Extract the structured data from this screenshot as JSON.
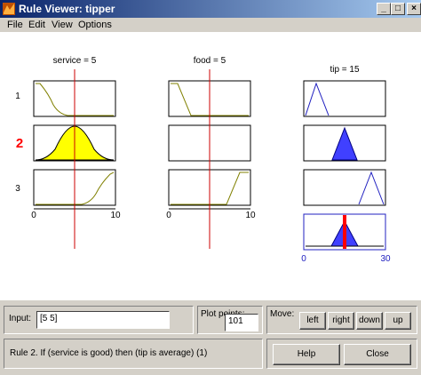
{
  "window": {
    "title": "Rule Viewer: tipper"
  },
  "menu": [
    "File",
    "Edit",
    "View",
    "Options"
  ],
  "columns": {
    "service": {
      "label": "service = 5"
    },
    "food": {
      "label": "food = 5"
    },
    "tip": {
      "label": "tip = 15"
    }
  },
  "rules": [
    "1",
    "2",
    "3"
  ],
  "active_rule_index": 2,
  "axes": {
    "input_min": "0",
    "input_max": "10",
    "output_min": "0",
    "output_max": "30"
  },
  "bottom": {
    "input_label": "Input:",
    "input_value": "[5 5]",
    "plot_points_label": "Plot points:",
    "plot_points_value": "101",
    "move_label": "Move:",
    "move_buttons": [
      "left",
      "right",
      "down",
      "up"
    ],
    "status_text": "Rule 2. If (service is good) then (tip is average) (1)",
    "help_label": "Help",
    "close_label": "Close"
  },
  "colors": {
    "active_rule": "#ff0000",
    "input_fill": "#ffff00",
    "output_fill": "#4040ff",
    "index_line": "#cc0000"
  }
}
